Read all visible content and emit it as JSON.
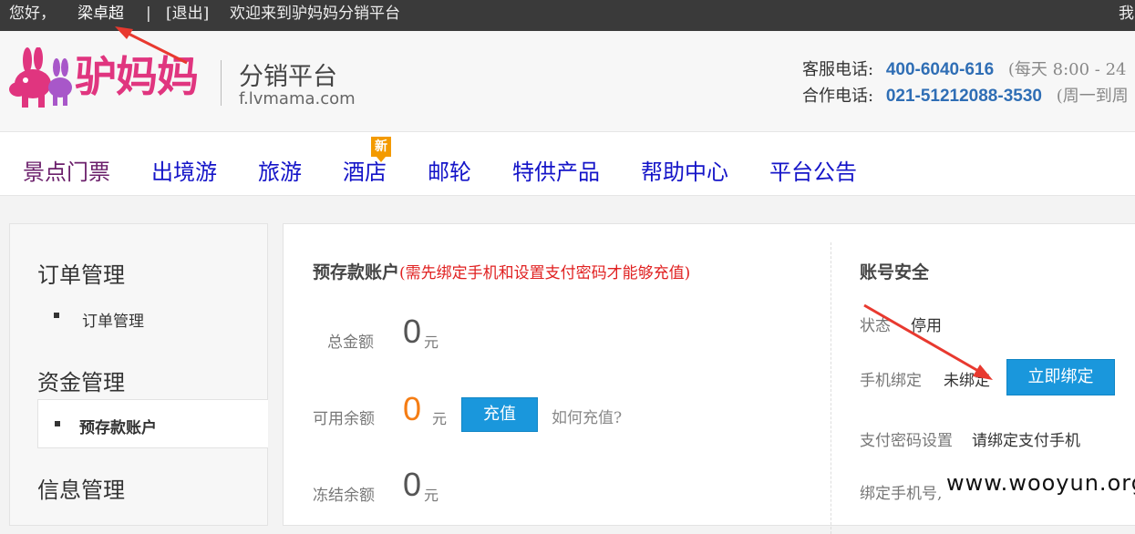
{
  "topbar": {
    "greeting": "您好，",
    "username": "梁卓超",
    "separator": "|",
    "logout": "[退出]",
    "welcome": "欢迎来到驴妈妈分销平台",
    "right_link": "我"
  },
  "header": {
    "brand_name": "驴妈妈",
    "platform_title": "分销平台",
    "platform_url": "f.lvmama.com",
    "service_label": "客服电话:",
    "service_phone": "400-6040-616",
    "service_note": "(每天   8:00 - 24",
    "coop_label": "合作电话:",
    "coop_phone": "021-51212088-3530",
    "coop_note": "(周一到周"
  },
  "nav": {
    "items": [
      {
        "label": "景点门票"
      },
      {
        "label": "出境游"
      },
      {
        "label": "旅游"
      },
      {
        "label": "酒店"
      },
      {
        "label": "邮轮"
      },
      {
        "label": "特供产品"
      },
      {
        "label": "帮助中心"
      },
      {
        "label": "平台公告"
      }
    ],
    "new_badge": "新"
  },
  "sidebar": {
    "sections": [
      {
        "heading": "订单管理",
        "items": [
          "订单管理"
        ]
      },
      {
        "heading": "资金管理",
        "items": [
          "预存款账户"
        ]
      },
      {
        "heading": "信息管理",
        "items": []
      }
    ]
  },
  "deposit": {
    "title": "预存款账户",
    "note": "(需先绑定手机和设置支付密码才能够充值)",
    "total_label": "总金额",
    "total_value": "0",
    "total_unit": "元",
    "available_label": "可用余额",
    "available_value": "0",
    "available_unit": "元",
    "recharge_button": "充值",
    "how_to_recharge": "如何充值?",
    "frozen_label": "冻结余额",
    "frozen_value": "0",
    "frozen_unit": "元"
  },
  "security": {
    "title": "账号安全",
    "status_label": "状态",
    "status_value": "停用",
    "phone_bind_label": "手机绑定",
    "phone_bind_value": "未绑定",
    "bind_button": "立即绑定",
    "pay_pwd_label": "支付密码设置",
    "pay_pwd_value": "请绑定支付手机",
    "bound_phone_label": "绑定手机号,"
  },
  "watermark": "www.wooyun.org",
  "colors": {
    "brand_pink": "#e0357f",
    "nav_link": "#1414c8",
    "phone_blue": "#2f6eb5",
    "button_blue": "#1a97dc",
    "warning_red": "#e02020",
    "amount_orange": "#f57d14",
    "annotation_red": "#e8392f"
  }
}
